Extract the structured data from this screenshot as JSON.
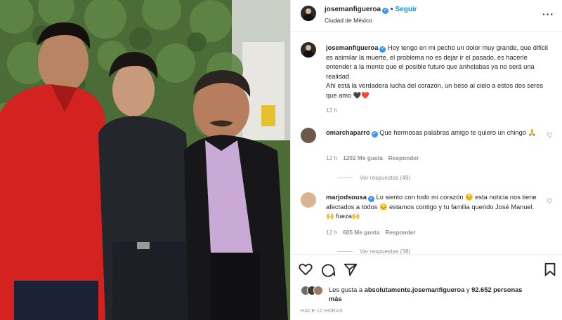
{
  "header": {
    "username": "josemanfigueroa",
    "follow_label": "Seguir",
    "location": "Ciudad de México",
    "more_icon": "ellipsis-icon"
  },
  "caption": {
    "username": "josemanfigueroa",
    "text": "Hoy tengo en mi pecho un dolor muy grande, que difícil es asimilar la muerte, el problema no es dejar ir el pasado, es hacerle entender a la mente que el posible futuro que anhelabas ya no será una realidad.",
    "text2": "Ahí está la verdadera lucha del corazón, un beso al cielo a estos dos seres que amo 🖤❤️",
    "time": "12 h"
  },
  "comments": [
    {
      "username": "omarchaparro",
      "text": "Que hermosas palabras amigo te quiero un chingo 🙏",
      "time": "12 h",
      "likes": "1202 Me gusta",
      "reply_label": "Responder",
      "view_replies": "Ver respuestas (48)"
    },
    {
      "username": "marjodsousa",
      "text": "Lo siento con todo mi corazón 😔 esta noticia nos tiene afectados a todos 😔 estamos contigo y tu familia querido José Manuel. 🙌 fueza🙌",
      "time": "12 h",
      "likes": "605 Me gusta",
      "reply_label": "Responder",
      "view_replies": "Ver respuestas (38)"
    }
  ],
  "likes": {
    "prefix": "Les gusta a",
    "user": "absolutamente.josemanfigueroa",
    "middle": "y",
    "count": "92.652 personas",
    "suffix": "más"
  },
  "posted_ago": "HACE 12 HORAS",
  "colors": {
    "accent": "#0095f6",
    "verified": "#3897f0",
    "muted": "#8e8e8e"
  }
}
